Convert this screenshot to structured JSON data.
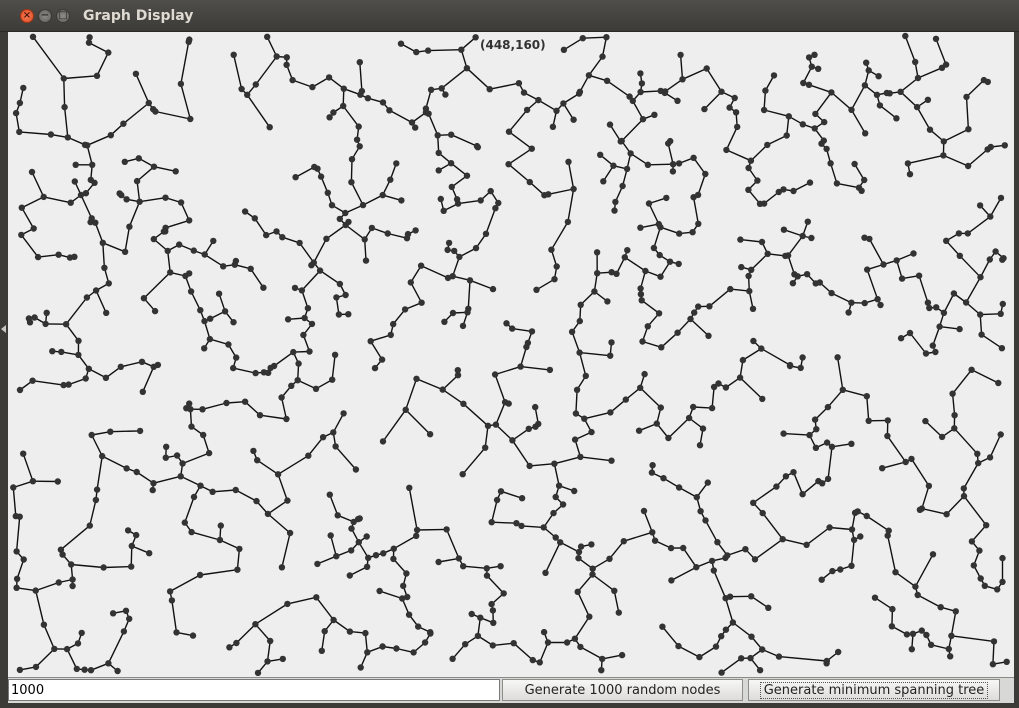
{
  "window": {
    "title": "Graph Display"
  },
  "canvas": {
    "cursor_coords": "(448,160)",
    "background": "#eeeeee",
    "edge_color": "#111111",
    "node_color": "#333333"
  },
  "controls": {
    "node_count_value": "1000",
    "generate_label": "Generate 1000 random nodes",
    "mst_label": "Generate minimum spanning tree"
  },
  "icons": {
    "close": "close-icon",
    "minimize": "minimize-icon",
    "maximize": "maximize-icon"
  }
}
